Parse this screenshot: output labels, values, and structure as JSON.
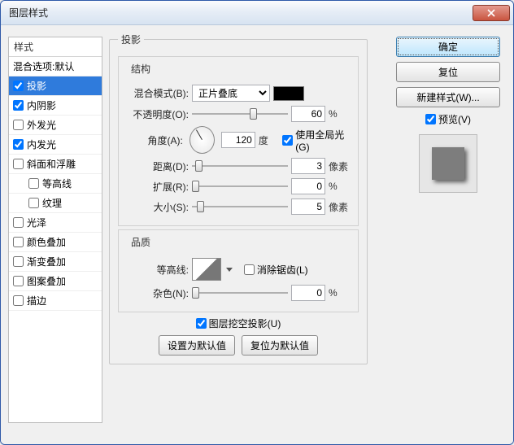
{
  "window": {
    "title": "图层样式"
  },
  "styles": {
    "header": "样式",
    "blend": "混合选项:默认",
    "items": [
      {
        "label": "投影",
        "checked": true,
        "selected": true
      },
      {
        "label": "内阴影",
        "checked": true
      },
      {
        "label": "外发光",
        "checked": false
      },
      {
        "label": "内发光",
        "checked": true
      },
      {
        "label": "斜面和浮雕",
        "checked": false
      },
      {
        "label": "等高线",
        "checked": false,
        "indent": true
      },
      {
        "label": "纹理",
        "checked": false,
        "indent": true
      },
      {
        "label": "光泽",
        "checked": false
      },
      {
        "label": "颜色叠加",
        "checked": false
      },
      {
        "label": "渐变叠加",
        "checked": false
      },
      {
        "label": "图案叠加",
        "checked": false
      },
      {
        "label": "描边",
        "checked": false
      }
    ]
  },
  "panel": {
    "title": "投影",
    "structure": {
      "legend": "结构",
      "blendMode": {
        "label": "混合模式(B):",
        "value": "正片叠底"
      },
      "opacity": {
        "label": "不透明度(O):",
        "value": "60",
        "unit": "%",
        "pos": 60
      },
      "angle": {
        "label": "角度(A):",
        "value": "120",
        "unit": "度"
      },
      "globalLight": {
        "label": "使用全局光(G)",
        "checked": true
      },
      "distance": {
        "label": "距离(D):",
        "value": "3",
        "unit": "像素",
        "pos": 3
      },
      "spread": {
        "label": "扩展(R):",
        "value": "0",
        "unit": "%",
        "pos": 0
      },
      "size": {
        "label": "大小(S):",
        "value": "5",
        "unit": "像素",
        "pos": 5
      }
    },
    "quality": {
      "legend": "品质",
      "contour": {
        "label": "等高线:"
      },
      "antiAlias": {
        "label": "消除锯齿(L)",
        "checked": false
      },
      "noise": {
        "label": "杂色(N):",
        "value": "0",
        "unit": "%",
        "pos": 0
      }
    },
    "knockout": {
      "label": "图层挖空投影(U)",
      "checked": true
    },
    "setDefault": "设置为默认值",
    "resetDefault": "复位为默认值"
  },
  "buttons": {
    "ok": "确定",
    "cancel": "复位",
    "newStyle": "新建样式(W)...",
    "preview": "预览(V)"
  }
}
